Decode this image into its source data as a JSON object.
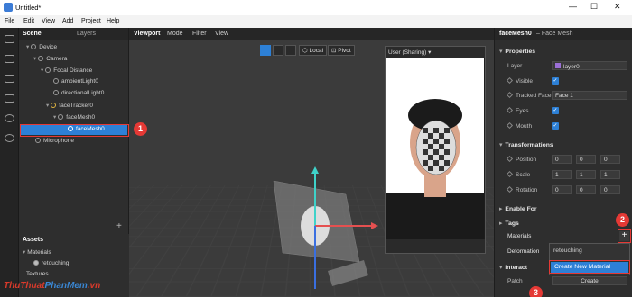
{
  "window": {
    "title": "Untitled*",
    "controls": [
      "—",
      "☐",
      "✕"
    ]
  },
  "menu": [
    "File",
    "Edit",
    "View",
    "Add",
    "Project",
    "Help"
  ],
  "scene_panel": {
    "tabs": [
      "Scene",
      "Layers"
    ],
    "tree": [
      {
        "label": "Device",
        "depth": 0
      },
      {
        "label": "Camera",
        "depth": 1
      },
      {
        "label": "Focal Distance",
        "depth": 2
      },
      {
        "label": "ambientLight0",
        "depth": 3
      },
      {
        "label": "directionalLight0",
        "depth": 3
      },
      {
        "label": "faceTracker0",
        "depth": 2
      },
      {
        "label": "faceMesh0",
        "depth": 3
      },
      {
        "label": "faceMesh0",
        "depth": 4,
        "selected": true
      },
      {
        "label": "Microphone",
        "depth": 1
      }
    ],
    "add": "+"
  },
  "assets_panel": {
    "title": "Assets",
    "materials_label": "Materials",
    "material_item": "retouching",
    "textures_label": "Textures"
  },
  "viewport": {
    "tabs": [
      "Viewport",
      "Mode",
      "Filter",
      "View"
    ],
    "toolbar": {
      "local": "Local",
      "pivot": "Pivot"
    },
    "preview_title": "User (Sharing)"
  },
  "inspector": {
    "header_title": "faceMesh0",
    "header_sub": "– Face Mesh",
    "properties": {
      "title": "Properties",
      "layer_label": "Layer",
      "layer_value": "layer0",
      "visible_label": "Visible",
      "tracked_face_label": "Tracked Face",
      "tracked_face_value": "Face 1",
      "eyes_label": "Eyes",
      "mouth_label": "Mouth"
    },
    "transformations": {
      "title": "Transformations",
      "position_label": "Position",
      "position": [
        "0",
        "0",
        "0"
      ],
      "scale_label": "Scale",
      "scale": [
        "1",
        "1",
        "1"
      ],
      "rotation_label": "Rotation",
      "rotation": [
        "0",
        "0",
        "0"
      ]
    },
    "enable_for": "Enable For",
    "tags": "Tags",
    "materials": "Materials",
    "deformation": "Deformation",
    "interaction": "Interact",
    "patch_label": "Patch",
    "create_label": "Create",
    "add": "+"
  },
  "dropdown": {
    "item": "retouching",
    "create_new": "Create New Material"
  },
  "callouts": [
    "1",
    "2",
    "3"
  ],
  "watermark": {
    "part1": "ThuThuat",
    "part2": "PhanMem",
    "part3": ".vn"
  },
  "colors": {
    "accent": "#2d80d6",
    "callout": "#e53935",
    "panel": "#2e2e2e"
  }
}
